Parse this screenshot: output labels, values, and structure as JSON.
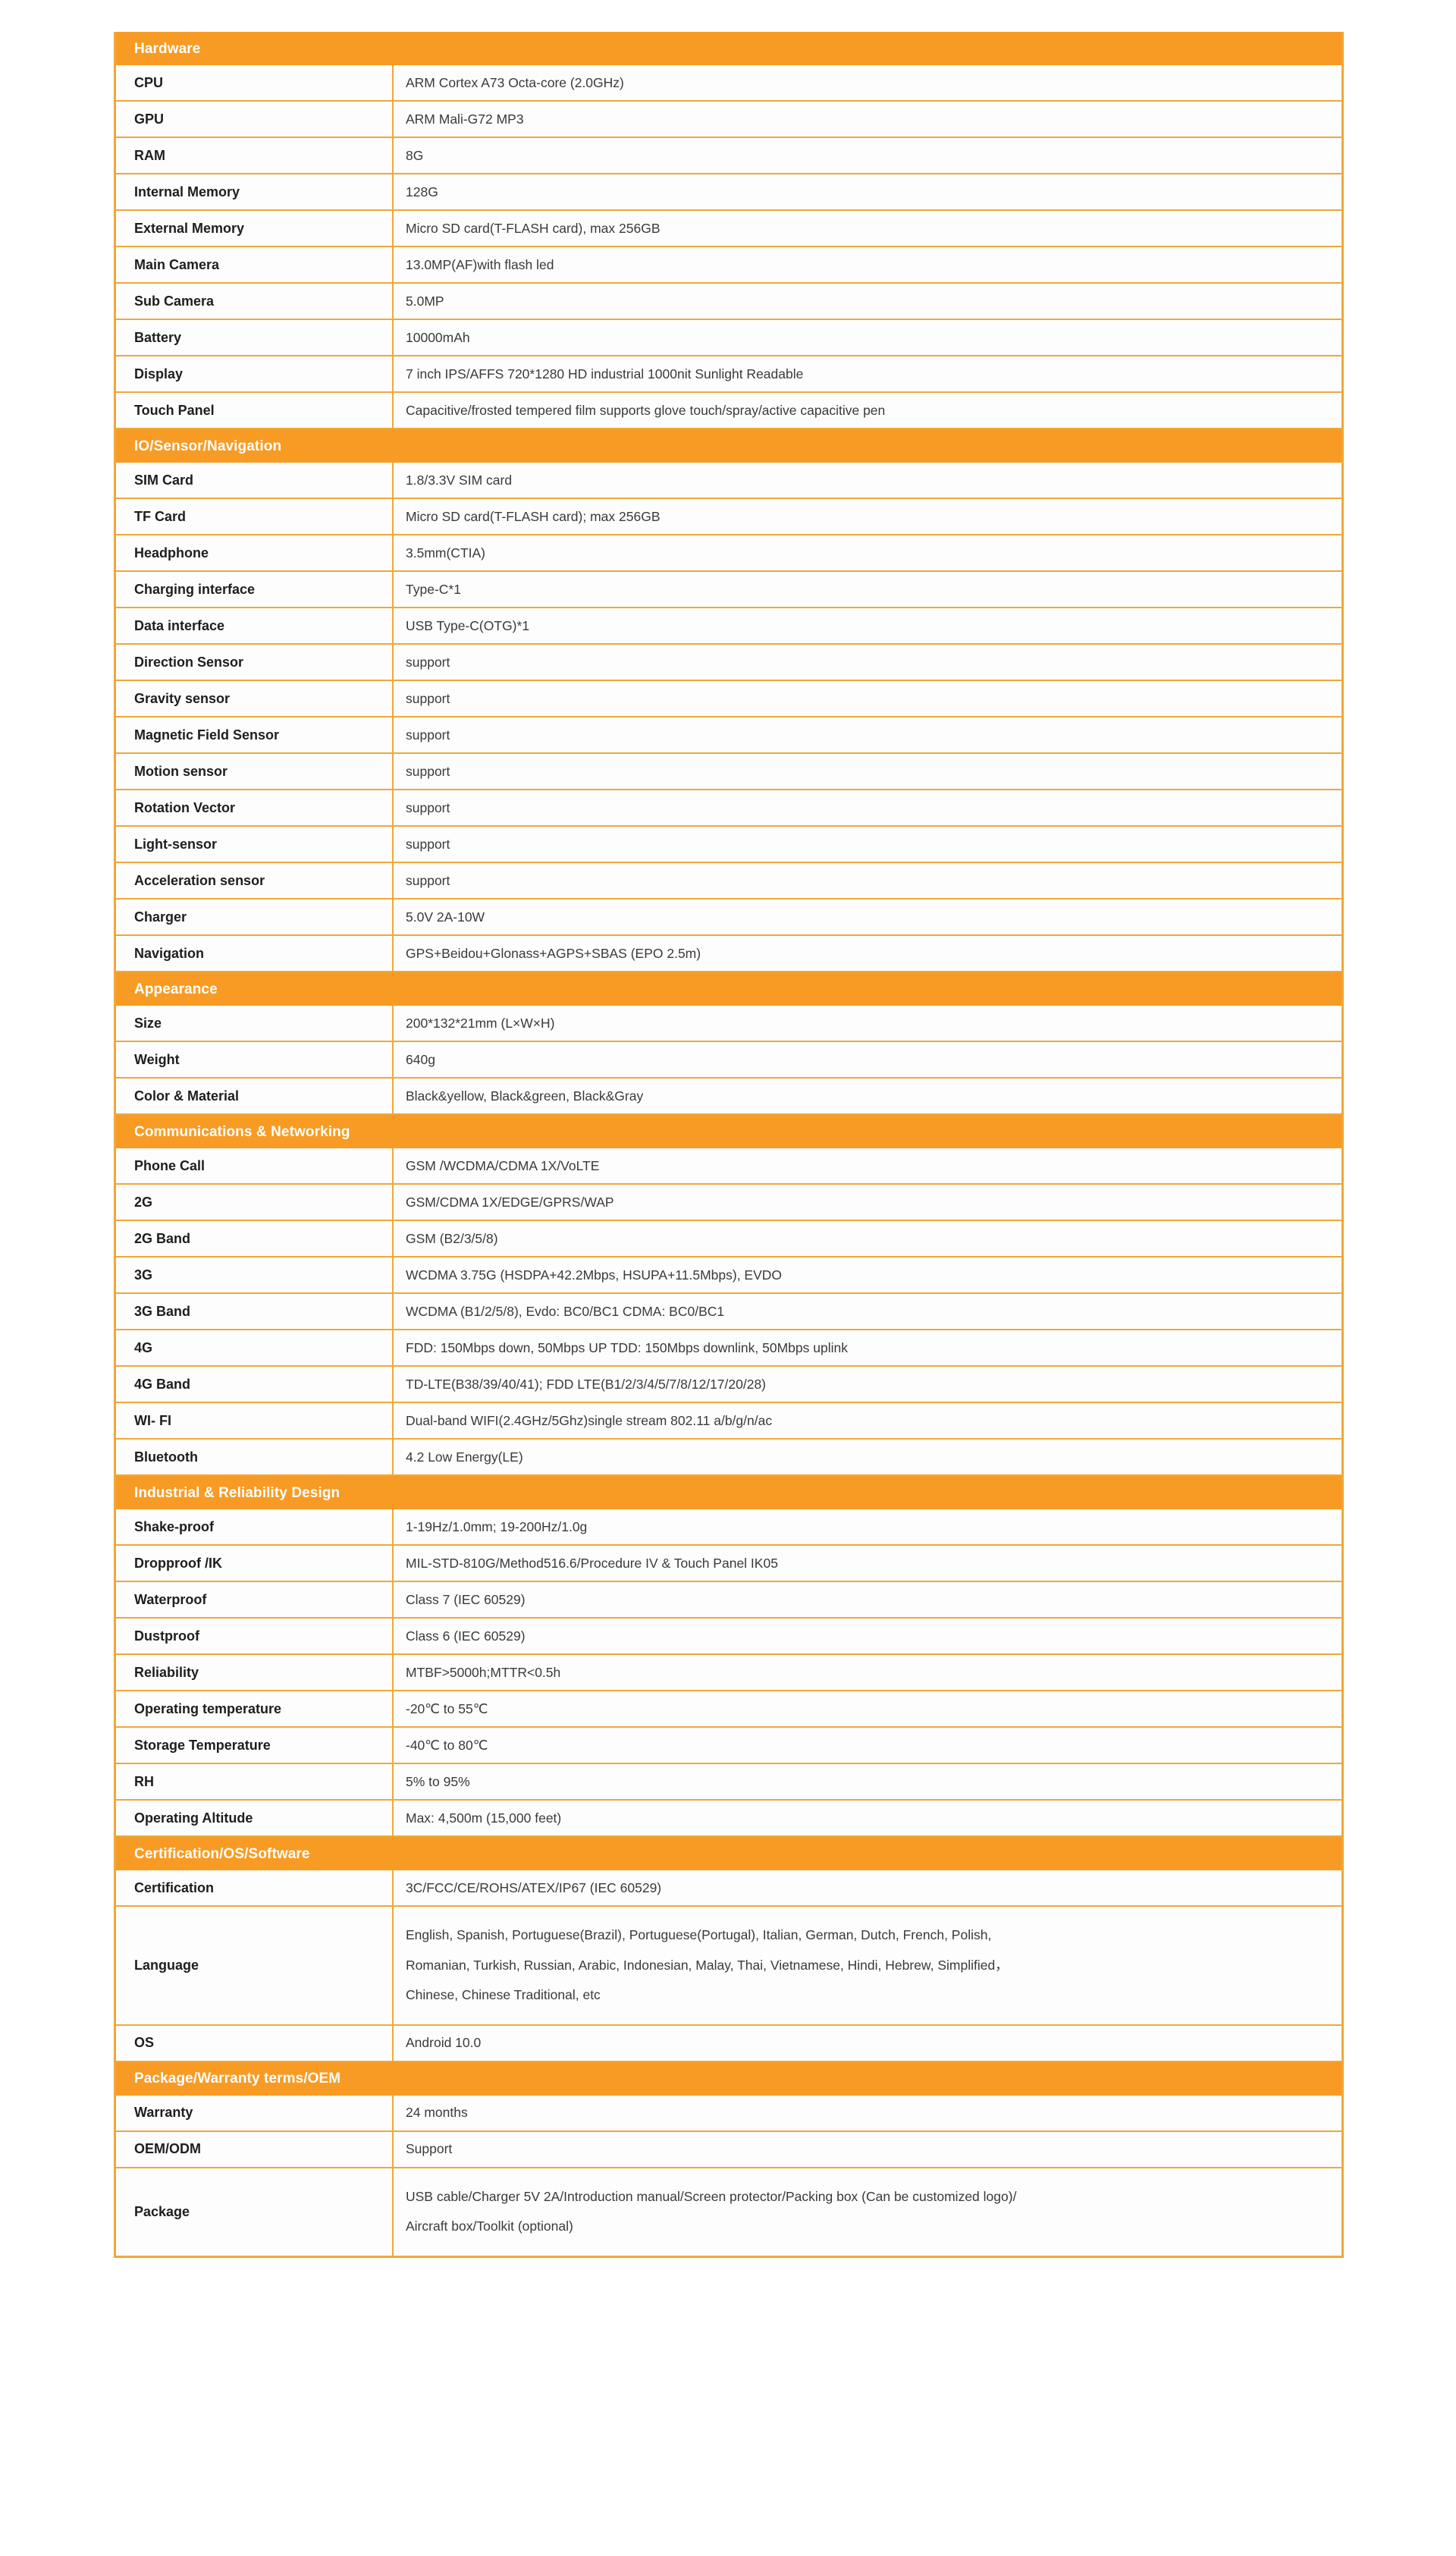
{
  "theme": {
    "header_bg": "#F89B24",
    "header_text": "#FFFFFF",
    "border": "#EFA83A",
    "row_bg": "#FDFDFD",
    "label_text": "#1E1E1E",
    "value_text": "#3A3A3A"
  },
  "sections": [
    {
      "title": "Hardware",
      "rows": [
        {
          "label": "CPU",
          "value": [
            "ARM Cortex A73 Octa-core (2.0GHz)"
          ]
        },
        {
          "label": "GPU",
          "value": [
            "ARM Mali-G72 MP3"
          ]
        },
        {
          "label": "RAM",
          "value": [
            "8G"
          ]
        },
        {
          "label": "Internal Memory",
          "value": [
            "128G"
          ]
        },
        {
          "label": "External Memory",
          "value": [
            "Micro SD card(T-FLASH card), max 256GB"
          ]
        },
        {
          "label": "Main Camera",
          "value": [
            "13.0MP(AF)with flash led"
          ]
        },
        {
          "label": "Sub Camera",
          "value": [
            "5.0MP"
          ]
        },
        {
          "label": "Battery",
          "value": [
            "10000mAh"
          ]
        },
        {
          "label": "Display",
          "value": [
            "7 inch IPS/AFFS 720*1280 HD industrial 1000nit Sunlight Readable"
          ]
        },
        {
          "label": "Touch Panel",
          "value": [
            "Capacitive/frosted tempered film supports glove touch/spray/active capacitive pen"
          ]
        }
      ]
    },
    {
      "title": "IO/Sensor/Navigation",
      "rows": [
        {
          "label": "SIM Card",
          "value": [
            "1.8/3.3V SIM card"
          ]
        },
        {
          "label": "TF Card",
          "value": [
            "Micro SD card(T-FLASH card); max 256GB"
          ]
        },
        {
          "label": "Headphone",
          "value": [
            "3.5mm(CTIA)"
          ]
        },
        {
          "label": "Charging interface",
          "value": [
            "Type-C*1"
          ]
        },
        {
          "label": "Data interface",
          "value": [
            "USB Type-C(OTG)*1"
          ]
        },
        {
          "label": "Direction Sensor",
          "value": [
            "support"
          ]
        },
        {
          "label": "Gravity sensor",
          "value": [
            "support"
          ]
        },
        {
          "label": "Magnetic Field Sensor",
          "value": [
            "support"
          ]
        },
        {
          "label": "Motion sensor",
          "value": [
            "support"
          ]
        },
        {
          "label": "Rotation Vector",
          "value": [
            "support"
          ]
        },
        {
          "label": "Light-sensor",
          "value": [
            "support"
          ]
        },
        {
          "label": "Acceleration sensor",
          "value": [
            "support"
          ]
        },
        {
          "label": "Charger",
          "value": [
            "5.0V 2A-10W"
          ]
        },
        {
          "label": "Navigation",
          "value": [
            "GPS+Beidou+Glonass+AGPS+SBAS (EPO 2.5m)"
          ]
        }
      ]
    },
    {
      "title": "Appearance",
      "rows": [
        {
          "label": "Size",
          "value": [
            "200*132*21mm (L×W×H)"
          ]
        },
        {
          "label": "Weight",
          "value": [
            "640g"
          ]
        },
        {
          "label": "Color & Material",
          "value": [
            "Black&yellow, Black&green, Black&Gray"
          ]
        }
      ]
    },
    {
      "title": "Communications & Networking",
      "rows": [
        {
          "label": "Phone Call",
          "value": [
            "GSM /WCDMA/CDMA 1X/VoLTE"
          ]
        },
        {
          "label": "2G",
          "value": [
            "GSM/CDMA 1X/EDGE/GPRS/WAP"
          ]
        },
        {
          "label": "2G Band",
          "value": [
            "GSM (B2/3/5/8)"
          ]
        },
        {
          "label": "3G",
          "value": [
            "WCDMA 3.75G (HSDPA+42.2Mbps, HSUPA+11.5Mbps), EVDO"
          ]
        },
        {
          "label": "3G Band",
          "value": [
            "WCDMA (B1/2/5/8), Evdo: BC0/BC1 CDMA: BC0/BC1"
          ]
        },
        {
          "label": "4G",
          "value": [
            "FDD: 150Mbps down, 50Mbps UP TDD: 150Mbps downlink, 50Mbps uplink"
          ]
        },
        {
          "label": "4G Band",
          "value": [
            "TD-LTE(B38/39/40/41); FDD LTE(B1/2/3/4/5/7/8/12/17/20/28)"
          ]
        },
        {
          "label": "WI- FI",
          "value": [
            "Dual-band WIFI(2.4GHz/5Ghz)single stream 802.11 a/b/g/n/ac"
          ]
        },
        {
          "label": "Bluetooth",
          "value": [
            "4.2 Low Energy(LE)"
          ]
        }
      ]
    },
    {
      "title": "Industrial & Reliability Design",
      "rows": [
        {
          "label": "Shake-proof",
          "value": [
            "1-19Hz/1.0mm; 19-200Hz/1.0g"
          ]
        },
        {
          "label": "Dropproof /IK",
          "value": [
            "MIL-STD-810G/Method516.6/Procedure IV & Touch Panel IK05"
          ]
        },
        {
          "label": "Waterproof",
          "value": [
            "Class 7 (IEC 60529)"
          ]
        },
        {
          "label": "Dustproof",
          "value": [
            "Class 6 (IEC 60529)"
          ]
        },
        {
          "label": "Reliability",
          "value": [
            "MTBF>5000h;MTTR<0.5h"
          ]
        },
        {
          "label": "Operating temperature",
          "value": [
            "-20℃ to 55℃"
          ]
        },
        {
          "label": "Storage Temperature",
          "value": [
            "-40℃ to 80℃"
          ]
        },
        {
          "label": "RH",
          "value": [
            "5% to 95%"
          ]
        },
        {
          "label": "Operating Altitude",
          "value": [
            "Max: 4,500m (15,000 feet)"
          ]
        }
      ]
    },
    {
      "title": "Certification/OS/Software",
      "rows": [
        {
          "label": "Certification",
          "value": [
            "3C/FCC/CE/ROHS/ATEX/IP67 (IEC 60529)"
          ]
        },
        {
          "label": "Language",
          "value": [
            "English, Spanish, Portuguese(Brazil), Portuguese(Portugal), Italian, German, Dutch, French, Polish,",
            "Romanian, Turkish, Russian, Arabic, Indonesian, Malay, Thai, Vietnamese, Hindi, Hebrew, Simplified，",
            "Chinese, Chinese Traditional, etc"
          ]
        },
        {
          "label": "OS",
          "value": [
            "Android 10.0"
          ]
        }
      ]
    },
    {
      "title": "Package/Warranty terms/OEM",
      "rows": [
        {
          "label": "Warranty",
          "value": [
            "24 months"
          ]
        },
        {
          "label": "OEM/ODM",
          "value": [
            "Support"
          ]
        },
        {
          "label": "Package",
          "value": [
            "USB cable/Charger 5V 2A/Introduction manual/Screen protector/Packing box (Can be customized logo)/",
            "Aircraft box/Toolkit (optional)"
          ]
        }
      ]
    }
  ]
}
